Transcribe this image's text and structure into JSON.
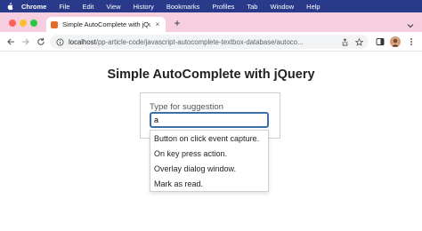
{
  "menubar": {
    "app_name": "Chrome",
    "items": [
      "File",
      "Edit",
      "View",
      "History",
      "Bookmarks",
      "Profiles",
      "Tab",
      "Window",
      "Help"
    ]
  },
  "tab": {
    "title": "Simple AutoComplete with jQu",
    "close": "×"
  },
  "newtab": "+",
  "address": {
    "host": "localhost",
    "path": "/pp-article-code/javascript-autocomplete-textbox-database/autoco..."
  },
  "page": {
    "title": "Simple AutoComplete with jQuery",
    "field_label": "Type for suggestion",
    "input_value": "a"
  },
  "suggestions": [
    "Button on click event capture.",
    "On key press action.",
    "Overlay dialog window.",
    "Mark as read."
  ],
  "colors": {
    "menubar": "#2a3a8a",
    "tabstrip": "#f5cfe0",
    "input_focus": "#3c6fa6"
  }
}
